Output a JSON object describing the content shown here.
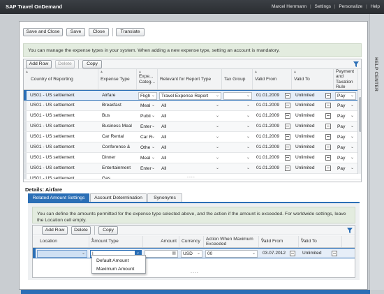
{
  "topbar": {
    "brand": "SAP Travel OnDemand",
    "user": "Marcel Herrmann",
    "links": [
      "Settings",
      "Personalize",
      "Help"
    ],
    "separator": "|"
  },
  "help_center": {
    "label": "HELP CENTER"
  },
  "toolbar": {
    "save_close": "Save and Close",
    "save": "Save",
    "close": "Close",
    "translate": "Translate"
  },
  "info_top": "You can manage the expense types in your system. When adding a new expense type, setting an account is mandatory.",
  "expense_grid": {
    "add_row": "Add Row",
    "delete": "Delete",
    "copy": "Copy",
    "columns": [
      "Country of Reporting",
      "Expense Type",
      "Expe... Categ...",
      "Relevant for Report Type",
      "Tax Group",
      "Valid From",
      "Valid To",
      "Payment and Taxation Rule"
    ],
    "rows": [
      {
        "country": "US01 - US settlement",
        "type": "Airfare",
        "cat": "Fligh",
        "report": "Travel Expense Report",
        "tax": "",
        "from": "01.01.2009",
        "to": "Unlimited",
        "rule": "Pay"
      },
      {
        "country": "US01 - US settlement",
        "type": "Breakfast",
        "cat": "Meal",
        "report": "All",
        "tax": "",
        "from": "01.01.2009",
        "to": "Unlimited",
        "rule": "Pay"
      },
      {
        "country": "US01 - US settlement",
        "type": "Bus",
        "cat": "Publi",
        "report": "All",
        "tax": "",
        "from": "01.01.2009",
        "to": "Unlimited",
        "rule": "Pay"
      },
      {
        "country": "US01 - US settlement",
        "type": "Business Meal",
        "cat": "Enter",
        "report": "All",
        "tax": "",
        "from": "01.01.2009",
        "to": "Unlimited",
        "rule": "Pay"
      },
      {
        "country": "US01 - US settlement",
        "type": "Car Rental",
        "cat": "Car R",
        "report": "All",
        "tax": "",
        "from": "01.01.2009",
        "to": "Unlimited",
        "rule": "Pay"
      },
      {
        "country": "US01 - US settlement",
        "type": "Conference &",
        "cat": "Othe",
        "report": "All",
        "tax": "",
        "from": "01.01.2009",
        "to": "Unlimited",
        "rule": "Pay"
      },
      {
        "country": "US01 - US settlement",
        "type": "Dinner",
        "cat": "Meal",
        "report": "All",
        "tax": "",
        "from": "01.01.2009",
        "to": "Unlimited",
        "rule": "Pay"
      },
      {
        "country": "US01 - US settlement",
        "type": "Entertainment",
        "cat": "Enter",
        "report": "All",
        "tax": "",
        "from": "01.01.2009",
        "to": "Unlimited",
        "rule": "Pay"
      },
      {
        "country": "US01 - US settlement",
        "type": "Gas",
        "cat": "",
        "report": "",
        "tax": "",
        "from": "",
        "to": "",
        "rule": ""
      }
    ],
    "more": "...."
  },
  "details": {
    "title": "Details: Airfare",
    "tabs": [
      "Related Amount Settings",
      "Account Determination",
      "Synonyms"
    ],
    "info": "You can define the amounts permitted for the expense type selected above, and the action if the amount is exceeded. For worldwide settings, leave the Location cell empty.",
    "add_row": "Add Row",
    "delete": "Delete",
    "copy": "Copy",
    "columns": [
      "Location",
      "Amount Type",
      "Amount",
      "Currency",
      "Action When Maximum Exceeded",
      "Valid From",
      "Valid To"
    ],
    "row": {
      "location": "",
      "amount_type": "|",
      "amount": "",
      "currency": "USD",
      "action": "00",
      "from": "03.07.2012",
      "to": "Unlimited"
    },
    "more": "....",
    "dropdown_options": [
      "Default Amount",
      "Maximum Amount"
    ]
  }
}
